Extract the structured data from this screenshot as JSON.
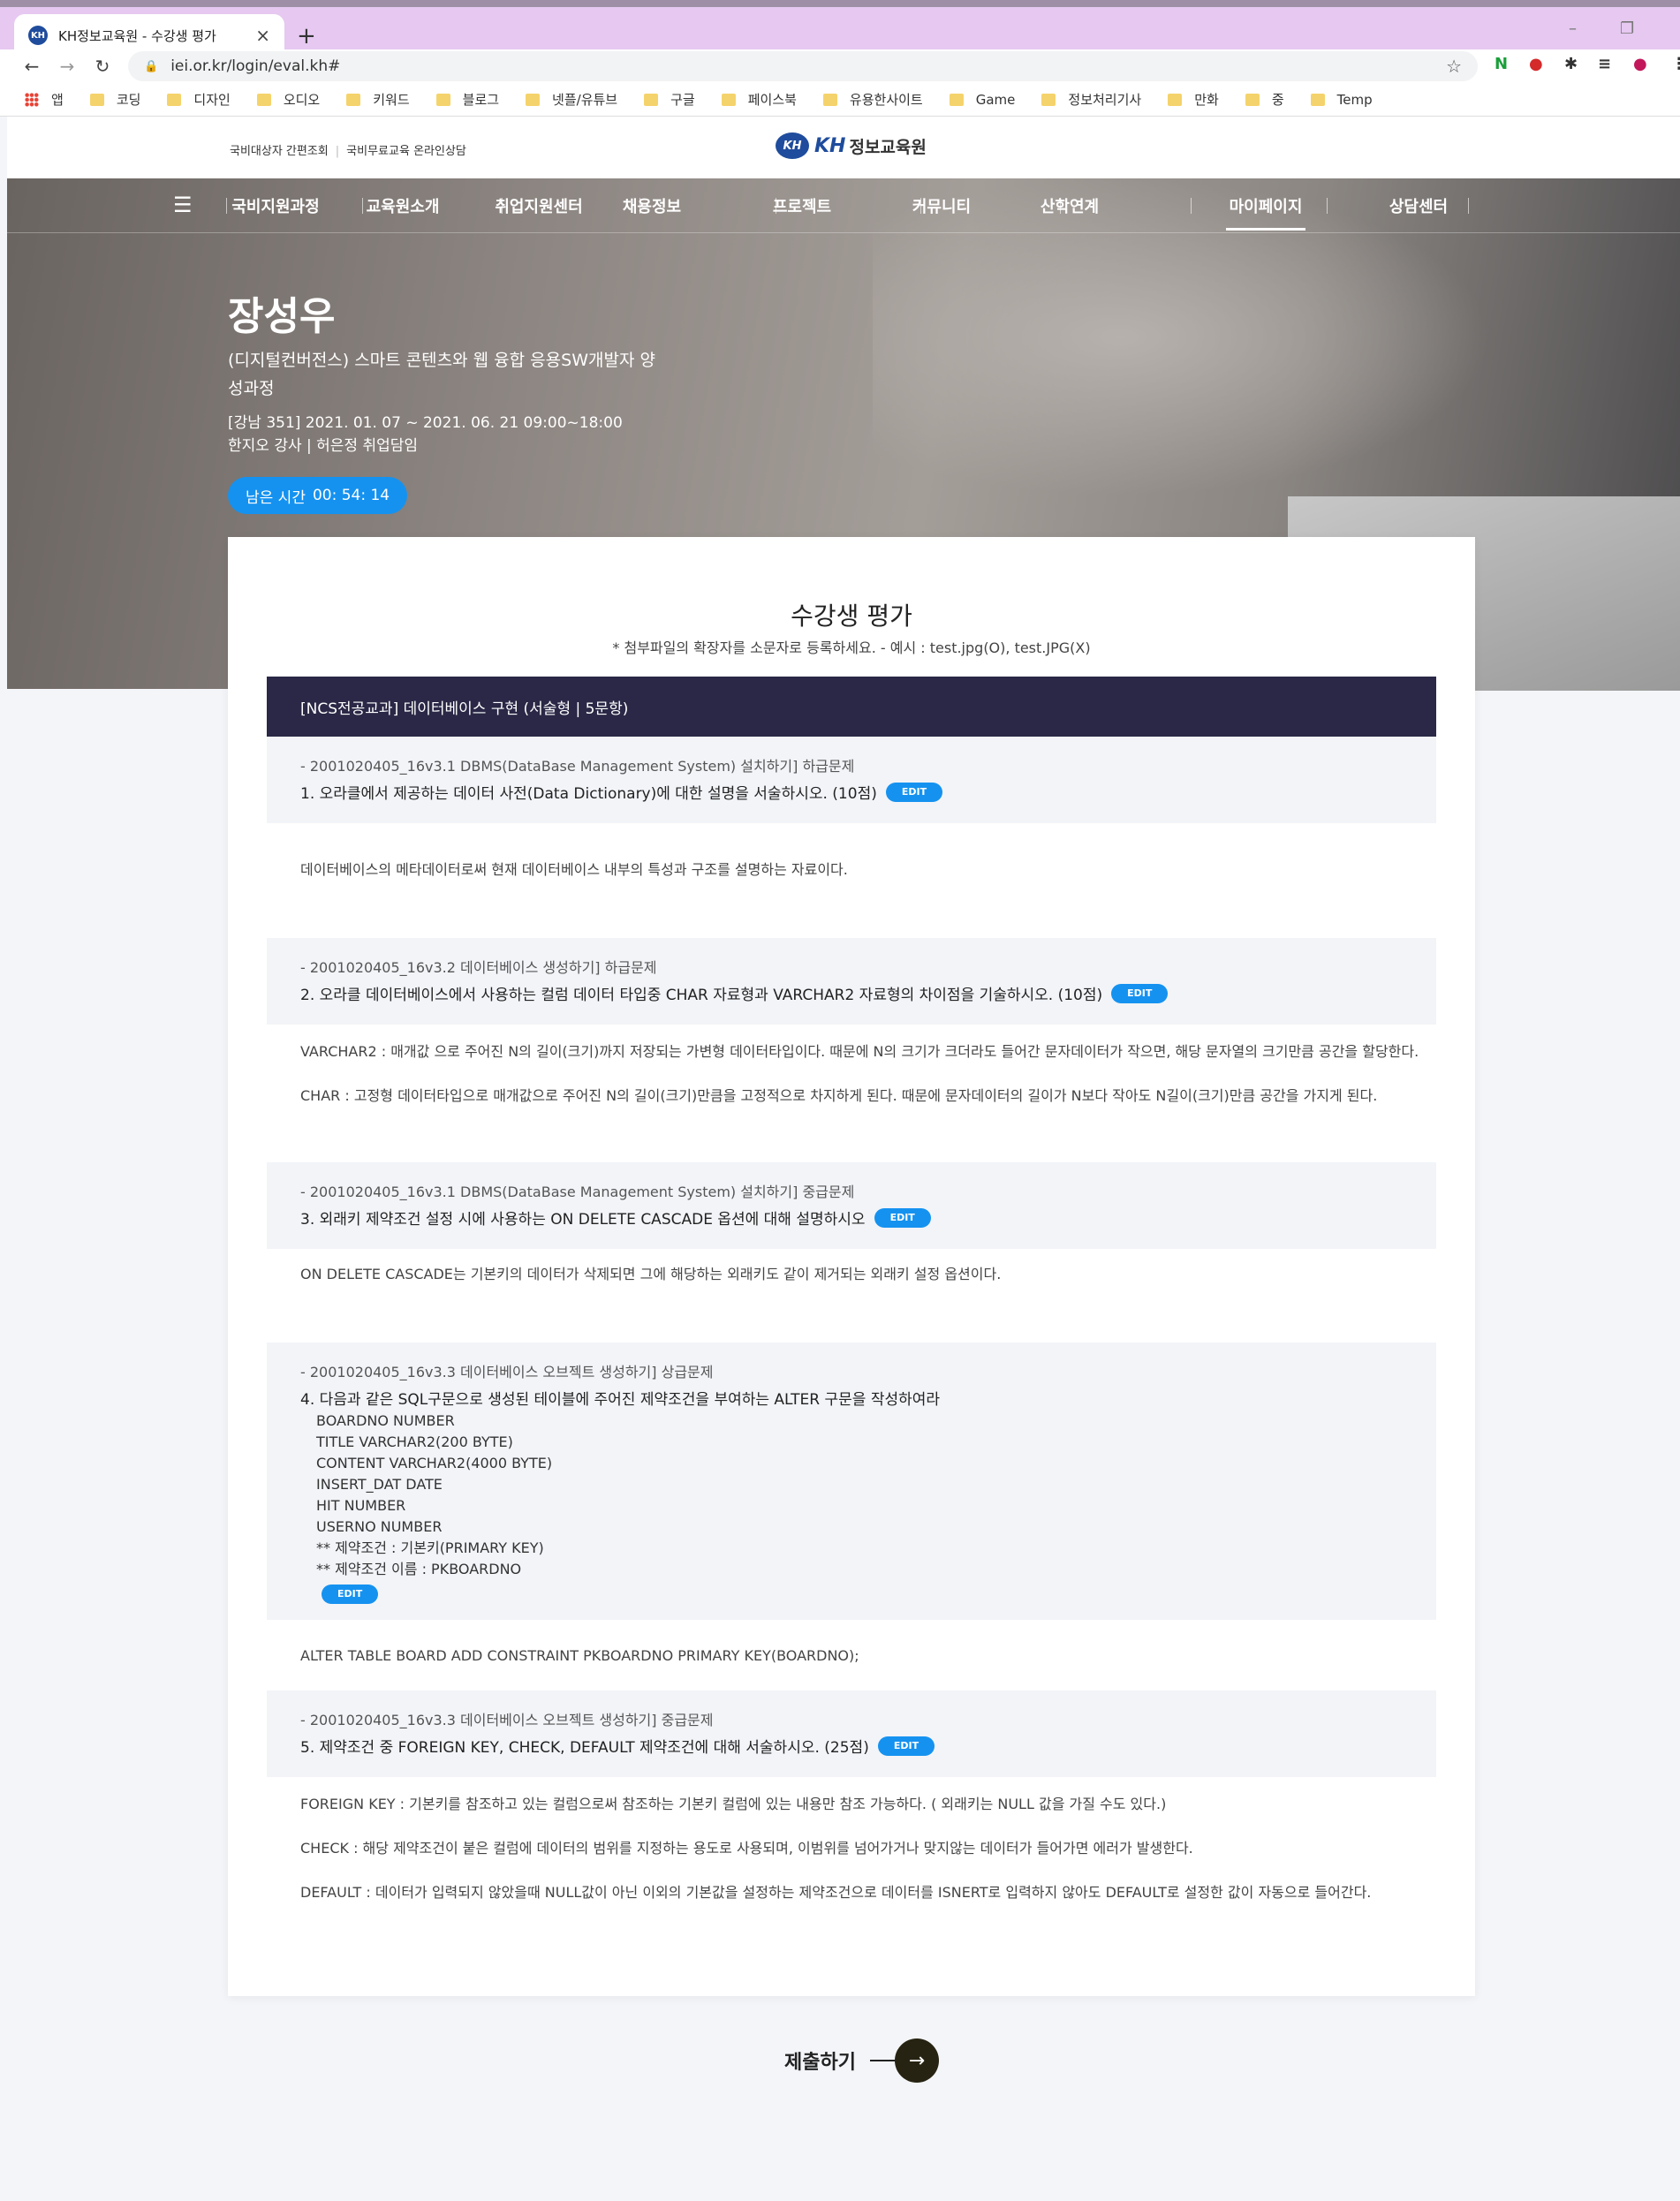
{
  "browser": {
    "tab_title": "KH정보교육원 - 수강생 평가",
    "tab_favicon": "KH",
    "new_tab": "+",
    "url": "iei.or.kr/login/eval.kh#",
    "bookmarks": [
      "앱",
      "코딩",
      "디자인",
      "오디오",
      "키워드",
      "블로그",
      "넷플/유튜브",
      "구글",
      "페이스북",
      "유용한사이트",
      "Game",
      "정보처리기사",
      "만화",
      "중",
      "Temp"
    ],
    "extension_n": "N"
  },
  "site": {
    "top_links": [
      "국비대상자 간편조회",
      "국비무료교육 온라인상담"
    ],
    "logo_mark": "KH",
    "logo_kh": "KH",
    "logo_name": "정보교육원",
    "nav": [
      "국비지원과정",
      "교육원소개",
      "취업지원센터",
      "채용정보",
      "프로젝트",
      "커뮤니티",
      "산학연계",
      "마이페이지",
      "상담센터"
    ],
    "active_nav": "마이페이지"
  },
  "student": {
    "name": "장성우",
    "course": "(디지털컨버전스) 스마트 콘텐츠와 웹 융합 응용SW개발자 양성과정",
    "period": "[강남 351] 2021. 01. 07 ~ 2021. 06. 21 09:00~18:00",
    "instructor": "한지오 강사 | 허은정 취업담임",
    "timer_label": "남은 시간",
    "timer_value": "00: 54: 14"
  },
  "eval": {
    "title": "수강생 평가",
    "note": "* 첨부파일의 확장자를 소문자로 등록하세요. - 예시 : test.jpg(O), test.JPG(X)",
    "section": "[NCS전공교과] 데이터베이스 구현 (서술형  |  5문항)",
    "edit_label": "EDIT",
    "questions": [
      {
        "code": "- 2001020405_16v3.1 DBMS(DataBase Management System) 설치하기]   하급문제",
        "text": "1. 오라클에서 제공하는 데이터 사전(Data Dictionary)에 대한 설명을 서술하시오. (10점)",
        "answer": [
          "데이터베이스의 메타데이터로써 현재 데이터베이스 내부의 특성과 구조를 설명하는 자료이다."
        ]
      },
      {
        "code": "- 2001020405_16v3.2 데이터베이스 생성하기]   하급문제",
        "text": "2. 오라클 데이터베이스에서 사용하는 컬럼 데이터 타입중 CHAR 자료형과 VARCHAR2 자료형의 차이점을 기술하시오. (10점)",
        "answer": [
          "VARCHAR2 : 매개값 으로 주어진 N의 길이(크기)까지 저장되는 가변형 데이터타입이다. 때문에 N의 크기가 크더라도 들어간 문자데이터가 작으면, 해당 문자열의 크기만큼 공간을 할당한다.",
          "CHAR : 고정형 데이터타입으로 매개값으로 주어진 N의 길이(크기)만큼을 고정적으로 차지하게 된다. 때문에 문자데이터의 길이가 N보다 작아도 N길이(크기)만큼 공간을 가지게 된다."
        ]
      },
      {
        "code": "- 2001020405_16v3.1 DBMS(DataBase Management System) 설치하기]   중급문제",
        "text": "3. 외래키 제약조건 설정 시에 사용하는 ON DELETE CASCADE 옵션에 대해 설명하시오",
        "answer": [
          " ON DELETE CASCADE는 기본키의 데이터가 삭제되면 그에 해당하는 외래키도 같이 제거되는 외래키 설정 옵션이다."
        ]
      },
      {
        "code": "- 2001020405_16v3.3 데이터베이스 오브젝트 생성하기]   상급문제",
        "text": "4. 다음과 같은 SQL구문으로 생성된 테이블에 주어진 제약조건을 부여하는 ALTER 구문을 작성하여라",
        "lines": [
          "BOARDNO NUMBER",
          "TITLE VARCHAR2(200 BYTE)",
          "CONTENT VARCHAR2(4000 BYTE)",
          "INSERT_DAT DATE",
          "HIT NUMBER",
          "USERNO NUMBER",
          "** 제약조건 : 기본키(PRIMARY KEY)",
          "** 제약조건 이름 : PKBOARDNO"
        ],
        "answer": [
          "ALTER TABLE BOARD  ADD CONSTRAINT PKBOARDNO PRIMARY KEY(BOARDNO);"
        ]
      },
      {
        "code": "- 2001020405_16v3.3 데이터베이스 오브젝트 생성하기]   중급문제",
        "text": "5. 제약조건 중 FOREIGN KEY, CHECK, DEFAULT 제약조건에 대해 서술하시오. (25점)",
        "answer": [
          "FOREIGN KEY : 기본키를 참조하고 있는 컬럼으로써 참조하는 기본키 컬럼에 있는 내용만 참조 가능하다. ( 외래키는 NULL 값을 가질 수도 있다.)",
          "CHECK : 해당 제약조건이 붙은 컬럼에 데이터의 범위를 지정하는 용도로 사용되며, 이범위를 넘어가거나 맞지않는 데이터가 들어가면 에러가 발생한다.",
          "DEFAULT : 데이터가 입력되지 않았을때 NULL값이 아닌 이외의 기본값을 설정하는 제약조건으로 데이터를 ISNERT로 입력하지 않아도 DEFAULT로 설정한 값이 자동으로 들어간다."
        ]
      }
    ],
    "submit_label": "제출하기"
  }
}
